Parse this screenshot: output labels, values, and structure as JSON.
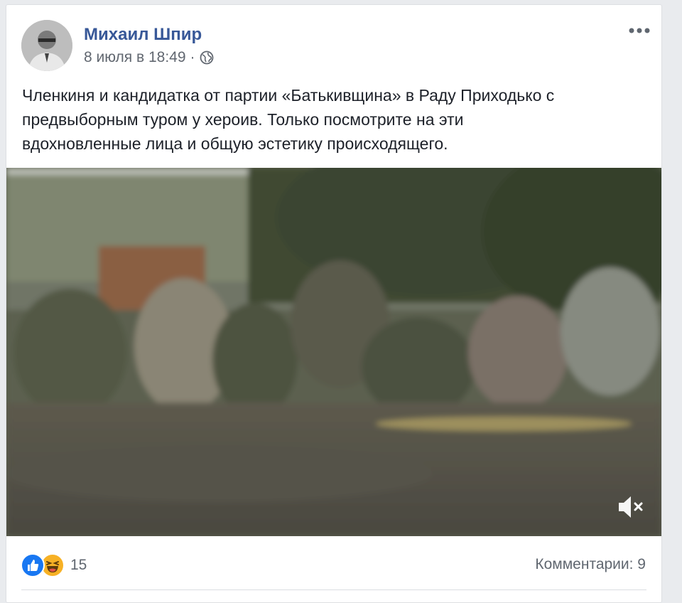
{
  "post": {
    "author": "Михаил Шпир",
    "date": "8 июля в 18:49",
    "separator": "·",
    "text_lines": [
      "Членкиня и кандидатка от партии «Батькивщина» в Раду Приходько с",
      "предвыборным туром у хероив. Только посмотрите на эти",
      "вдохновленные лица и общую эстетику происходящего."
    ]
  },
  "icons": {
    "globe": "globe-icon",
    "more": "more-options-icon",
    "mute": "muted-speaker-icon",
    "like": "like-reaction-icon",
    "haha": "haha-reaction-icon"
  },
  "reactions": {
    "count": "15"
  },
  "comments": {
    "label": "Комментарии: 9"
  },
  "colors": {
    "author_link": "#385898",
    "like_blue": "#1877f2",
    "haha_yellow": "#f7b125"
  }
}
